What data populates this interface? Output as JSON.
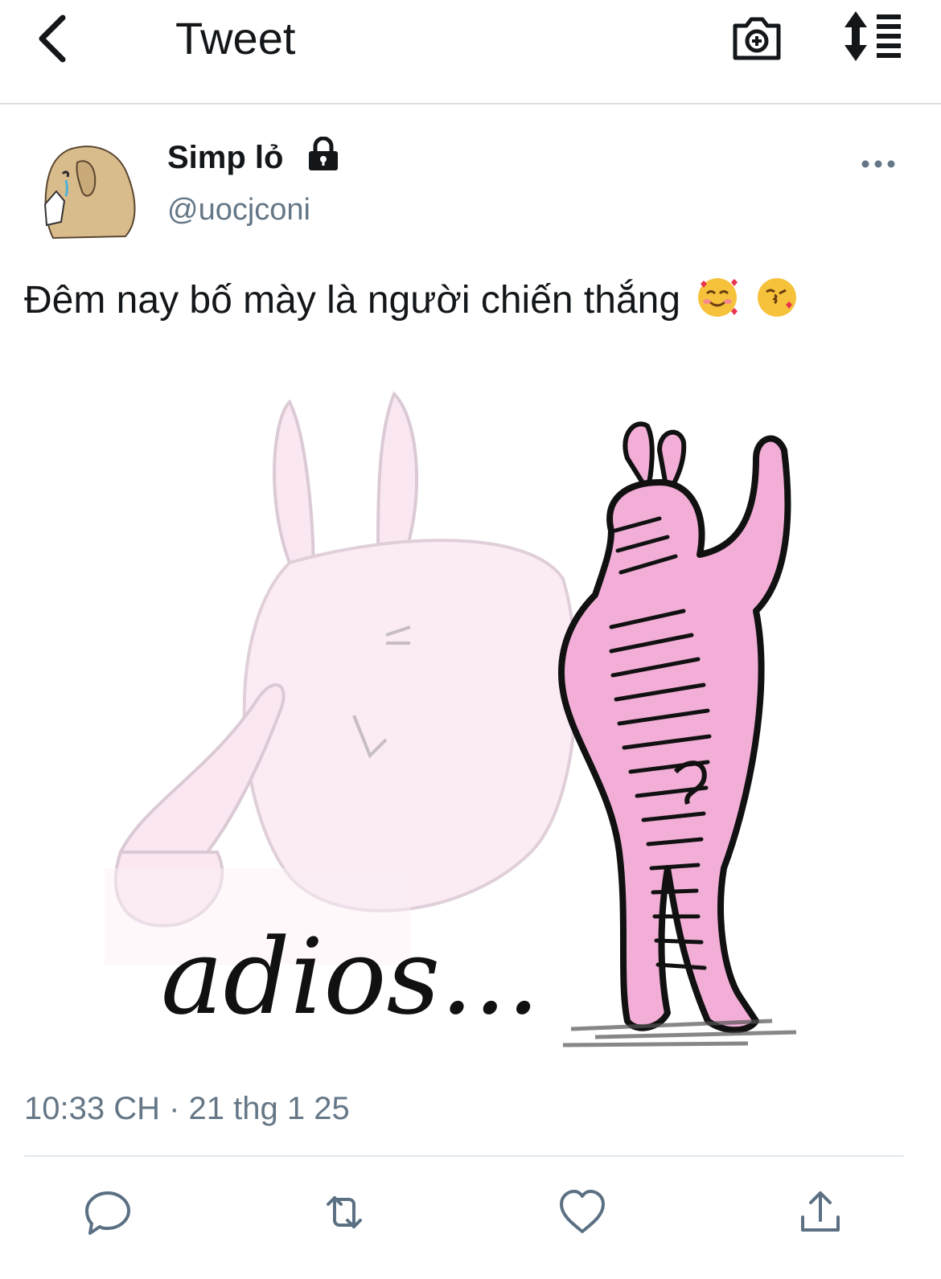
{
  "header": {
    "title": "Tweet",
    "back_icon": "chevron-left-icon",
    "camera_icon": "camera-plus-icon",
    "sort_icon": "sort-list-icon"
  },
  "tweet": {
    "author": {
      "display_name": "Simp lỏ",
      "handle": "@uocjconi",
      "protected": true
    },
    "text": "Đêm nay bố mày là người chiến thắng",
    "emojis": [
      "smiling-face-with-hearts",
      "face-blowing-kiss"
    ],
    "media": {
      "caption_text": "adios..."
    },
    "timestamp": "10:33 CH · 21 thg 1 25"
  },
  "actions": [
    "reply-icon",
    "retweet-icon",
    "like-icon",
    "share-icon"
  ],
  "colors": {
    "text": "#14171a",
    "secondary": "#657786",
    "action_icon": "#5b7083",
    "divider": "#e1e8ed",
    "avatar_tan": "#d9bc8c",
    "bunny_pink": "#f2aed6"
  }
}
